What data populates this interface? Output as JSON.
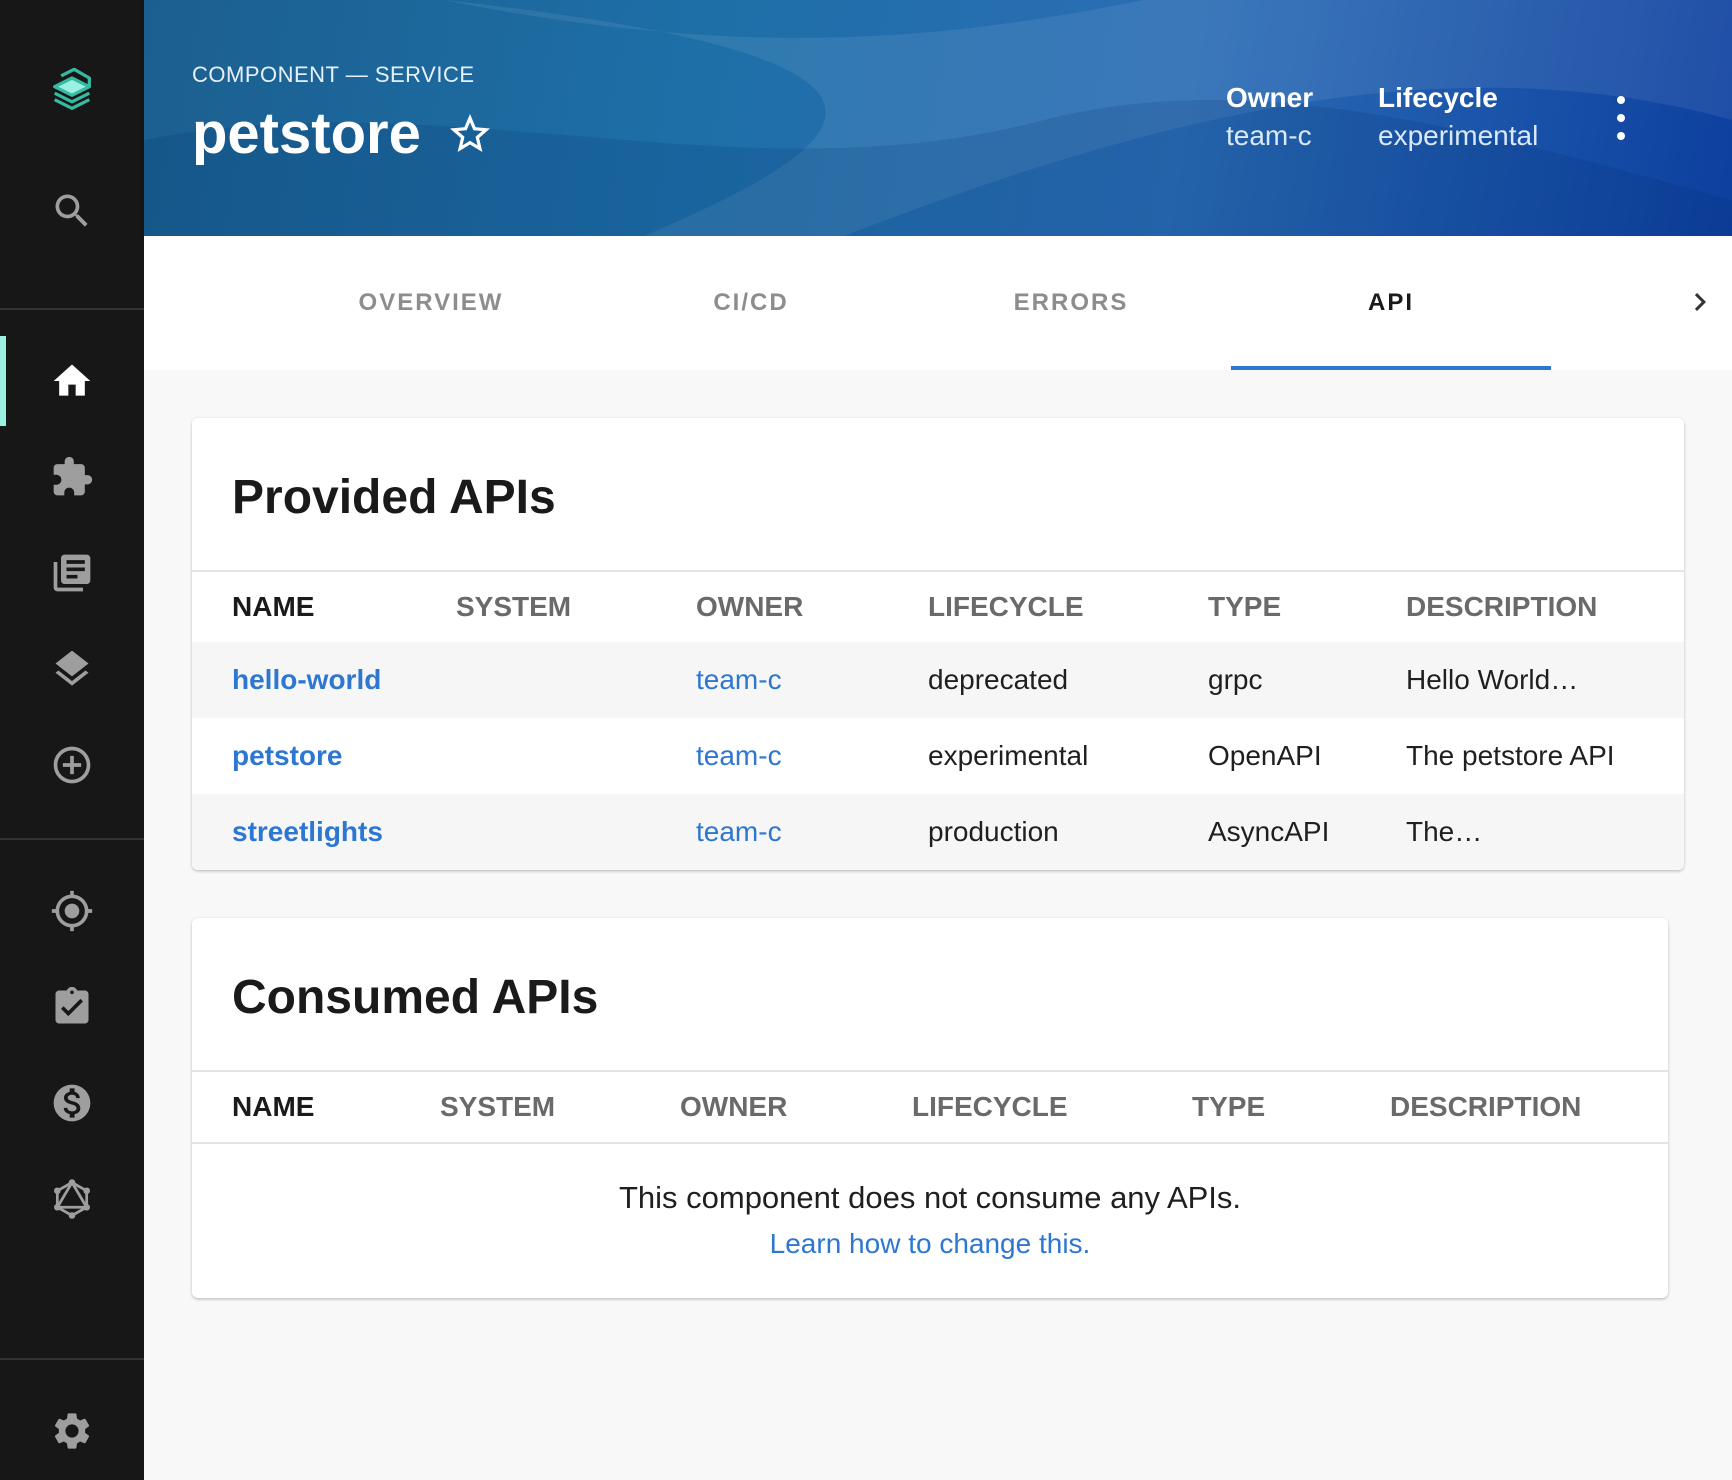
{
  "sidebar": {
    "items": [
      {
        "name": "logo-icon"
      },
      {
        "name": "search-icon"
      },
      {
        "name": "home-icon",
        "active": true
      },
      {
        "name": "puzzle-icon"
      },
      {
        "name": "docs-icon"
      },
      {
        "name": "layers-icon"
      },
      {
        "name": "add-circle-icon"
      },
      {
        "name": "target-icon"
      },
      {
        "name": "clipboard-check-icon"
      },
      {
        "name": "dollar-icon"
      },
      {
        "name": "graphql-icon"
      },
      {
        "name": "gear-icon"
      }
    ]
  },
  "header": {
    "breadcrumb": "COMPONENT — SERVICE",
    "title": "petstore",
    "owner_label": "Owner",
    "owner_value": "team-c",
    "lifecycle_label": "Lifecycle",
    "lifecycle_value": "experimental"
  },
  "tabs": [
    {
      "label": "OVERVIEW"
    },
    {
      "label": "CI/CD"
    },
    {
      "label": "ERRORS"
    },
    {
      "label": "API",
      "active": true
    }
  ],
  "provided": {
    "title": "Provided APIs",
    "columns": [
      "NAME",
      "SYSTEM",
      "OWNER",
      "LIFECYCLE",
      "TYPE",
      "DESCRIPTION"
    ],
    "rows": [
      {
        "name": "hello-world",
        "system": "",
        "owner": "team-c",
        "lifecycle": "deprecated",
        "type": "grpc",
        "description": "Hello World…"
      },
      {
        "name": "petstore",
        "system": "",
        "owner": "team-c",
        "lifecycle": "experimental",
        "type": "OpenAPI",
        "description": "The petstore API"
      },
      {
        "name": "streetlights",
        "system": "",
        "owner": "team-c",
        "lifecycle": "production",
        "type": "AsyncAPI",
        "description": "The…"
      }
    ]
  },
  "consumed": {
    "title": "Consumed APIs",
    "columns": [
      "NAME",
      "SYSTEM",
      "OWNER",
      "LIFECYCLE",
      "TYPE",
      "DESCRIPTION"
    ],
    "empty_message": "This component does not consume any APIs.",
    "empty_link": "Learn how to change this."
  },
  "colors": {
    "accent": "#2e77d0",
    "sidebar_bg": "#171717",
    "sidebar_active": "#9bf0e1"
  }
}
